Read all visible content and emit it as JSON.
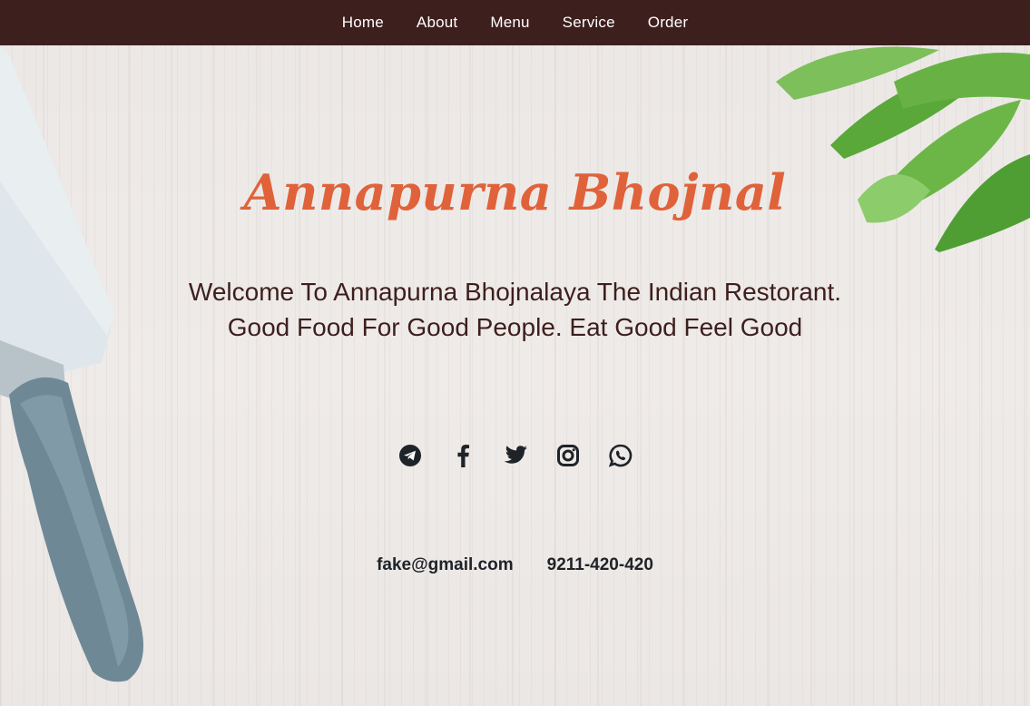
{
  "nav": {
    "items": [
      {
        "label": "Home"
      },
      {
        "label": "About"
      },
      {
        "label": "Menu"
      },
      {
        "label": "Service"
      },
      {
        "label": "Order"
      }
    ]
  },
  "hero": {
    "title": "Annapurna Bhojnal",
    "welcome_line1": "Welcome To Annapurna Bhojnalaya The Indian Restorant.",
    "welcome_line2": "Good Food For Good People. Eat Good Feel Good"
  },
  "social": {
    "icons": [
      "telegram-icon",
      "facebook-icon",
      "twitter-icon",
      "instagram-icon",
      "whatsapp-icon"
    ]
  },
  "contact": {
    "email": "fake@gmail.com",
    "phone": "9211-420-420"
  },
  "colors": {
    "navbar": "#3d1f1d",
    "title": "#e0623a",
    "welcome_text": "#3d1f1d",
    "icons": "#1e2328"
  }
}
